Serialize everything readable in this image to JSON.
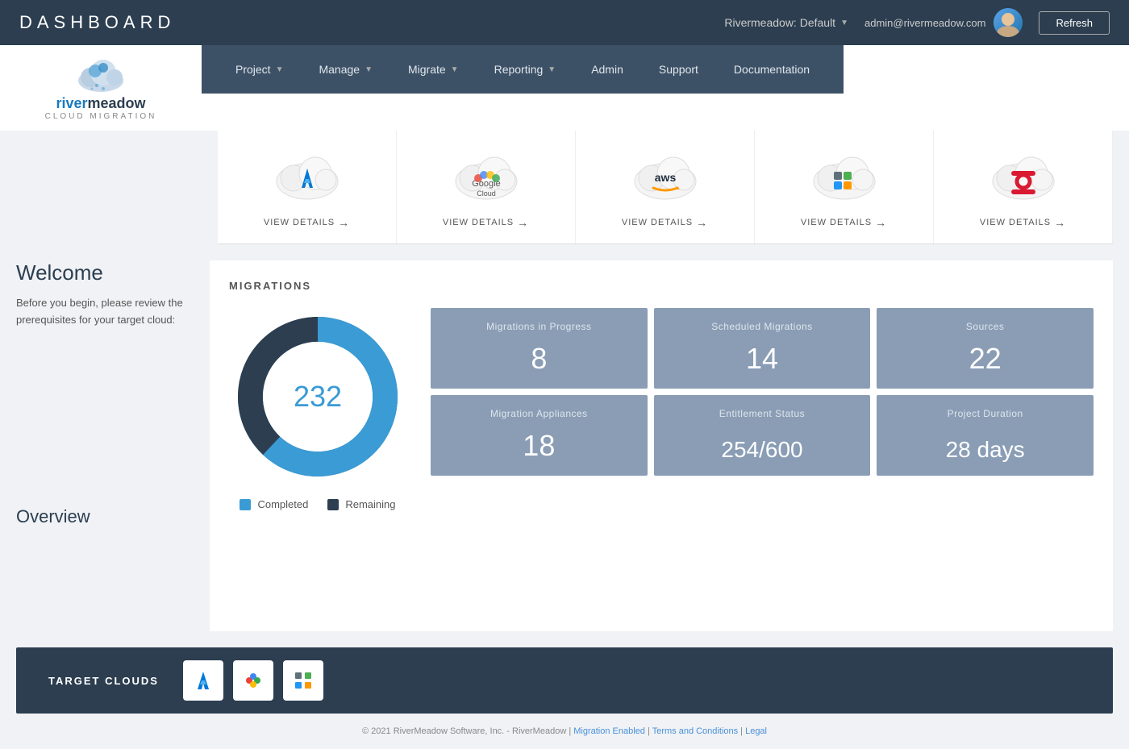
{
  "topbar": {
    "title": "DASHBOARD",
    "project": "Rivermeadow: Default",
    "user_email": "admin@rivermeadow.com",
    "refresh_label": "Refresh"
  },
  "nav": {
    "items": [
      {
        "label": "Project",
        "has_dropdown": true
      },
      {
        "label": "Manage",
        "has_dropdown": true
      },
      {
        "label": "Migrate",
        "has_dropdown": true
      },
      {
        "label": "Reporting",
        "has_dropdown": true
      },
      {
        "label": "Admin",
        "has_dropdown": false
      },
      {
        "label": "Support",
        "has_dropdown": false
      },
      {
        "label": "Documentation",
        "has_dropdown": false
      }
    ]
  },
  "logo": {
    "river": "river",
    "meadow": "meadow",
    "sub": "CLOUD MIGRATION"
  },
  "sidebar": {
    "welcome_title": "Welcome",
    "welcome_text": "Before you begin, please review the prerequisites for your target cloud:",
    "overview_title": "Overview"
  },
  "cloud_cards": [
    {
      "name": "Azure",
      "link_text": "VIEW DETAILS"
    },
    {
      "name": "Google Cloud",
      "link_text": "VIEW DETAILS"
    },
    {
      "name": "AWS",
      "link_text": "VIEW DETAILS"
    },
    {
      "name": "VMware",
      "link_text": "VIEW DETAILS"
    },
    {
      "name": "OpenStack",
      "link_text": "VIEW DETAILS"
    }
  ],
  "migrations": {
    "title": "MIGRATIONS",
    "total": "232",
    "legend_completed": "Completed",
    "legend_remaining": "Remaining",
    "completed_pct": 62,
    "remaining_pct": 38,
    "stats": [
      {
        "label": "Migrations in Progress",
        "value": "8"
      },
      {
        "label": "Scheduled  Migrations",
        "value": "14"
      },
      {
        "label": "Sources",
        "value": "22"
      },
      {
        "label": "Migration Appliances",
        "value": "18"
      },
      {
        "label": "Entitlement Status",
        "value": "254/600"
      },
      {
        "label": "Project Duration",
        "value": "28 days"
      }
    ]
  },
  "target_clouds": {
    "label": "TARGET CLOUDS",
    "icons": [
      "azure",
      "google-cloud",
      "vmware"
    ]
  },
  "footer": {
    "text": "© 2021 RiverMeadow Software, Inc. - RiverMeadow",
    "links": [
      "Migration Enabled",
      "Terms and Conditions",
      "Legal"
    ]
  },
  "colors": {
    "donut_completed": "#3a9bd5",
    "donut_remaining": "#2c3e50",
    "stat_card_bg": "#8a9db5"
  }
}
